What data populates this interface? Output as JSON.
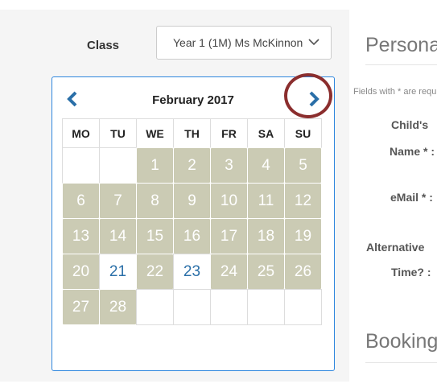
{
  "class_field": {
    "label": "Class",
    "selected": "Year 1 (1M) Ms McKinnon"
  },
  "calendar": {
    "month_title": "February 2017",
    "weekdays": [
      "MO",
      "TU",
      "WE",
      "TH",
      "FR",
      "SA",
      "SU"
    ],
    "weeks": [
      [
        {
          "d": "",
          "s": "empty"
        },
        {
          "d": "",
          "s": "empty"
        },
        {
          "d": "1",
          "s": "avail"
        },
        {
          "d": "2",
          "s": "avail"
        },
        {
          "d": "3",
          "s": "avail"
        },
        {
          "d": "4",
          "s": "avail"
        },
        {
          "d": "5",
          "s": "avail"
        }
      ],
      [
        {
          "d": "6",
          "s": "avail"
        },
        {
          "d": "7",
          "s": "avail"
        },
        {
          "d": "8",
          "s": "avail"
        },
        {
          "d": "9",
          "s": "avail"
        },
        {
          "d": "10",
          "s": "avail"
        },
        {
          "d": "11",
          "s": "avail"
        },
        {
          "d": "12",
          "s": "avail"
        }
      ],
      [
        {
          "d": "13",
          "s": "avail"
        },
        {
          "d": "14",
          "s": "avail"
        },
        {
          "d": "15",
          "s": "avail"
        },
        {
          "d": "16",
          "s": "avail"
        },
        {
          "d": "17",
          "s": "avail"
        },
        {
          "d": "18",
          "s": "avail"
        },
        {
          "d": "19",
          "s": "avail"
        }
      ],
      [
        {
          "d": "20",
          "s": "avail"
        },
        {
          "d": "21",
          "s": "selectable"
        },
        {
          "d": "22",
          "s": "avail"
        },
        {
          "d": "23",
          "s": "selectable"
        },
        {
          "d": "24",
          "s": "avail"
        },
        {
          "d": "25",
          "s": "avail"
        },
        {
          "d": "26",
          "s": "avail"
        }
      ],
      [
        {
          "d": "27",
          "s": "avail"
        },
        {
          "d": "28",
          "s": "avail"
        },
        {
          "d": "",
          "s": "empty"
        },
        {
          "d": "",
          "s": "empty"
        },
        {
          "d": "",
          "s": "empty"
        },
        {
          "d": "",
          "s": "empty"
        },
        {
          "d": "",
          "s": "empty"
        }
      ]
    ],
    "nav_color": "#2a6fa8",
    "highlight_color": "#8b2e2e"
  },
  "right_panel": {
    "section_title": "Personal",
    "fields_note": "Fields with * are required",
    "childs_label": "Child's",
    "name_label": "Name * :",
    "email_label": "eMail * :",
    "alternative_label": "Alternative",
    "time_label": "Time? :",
    "booking_title": "Booking"
  }
}
